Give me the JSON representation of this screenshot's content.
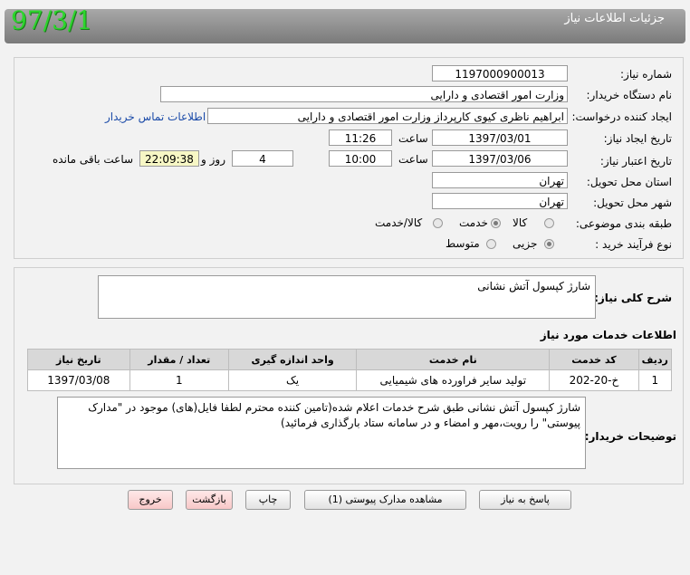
{
  "header": {
    "title": "جزئیات اطلاعات نیاز",
    "date_stamp": "97/3/1"
  },
  "form": {
    "need_number_label": "شماره نیاز:",
    "need_number": "1197000900013",
    "buyer_org_label": "نام دستگاه خریدار:",
    "buyer_org": "وزارت امور اقتصادی و دارایی",
    "requester_label": "ایجاد کننده درخواست:",
    "requester": "ابراهیم  ناظری کیوی کارپرداز وزارت امور اقتصادی و دارایی",
    "contact_link": "اطلاعات تماس خریدار",
    "created_label": "تاریخ ایجاد نیاز:",
    "created_date": "1397/03/01",
    "time_label": "ساعت",
    "created_time": "11:26",
    "validity_label": "تاریخ اعتبار نیاز:",
    "validity_date": "1397/03/06",
    "validity_time": "10:00",
    "days_value": "4",
    "days_label": "روز و",
    "remaining_time": "22:09:38",
    "remaining_label": "ساعت باقی مانده",
    "province_label": "استان محل تحویل:",
    "province": "تهران",
    "city_label": "شهر محل تحویل:",
    "city": "تهران",
    "category_label": "طبقه بندی موضوعی:",
    "category_options": [
      "کالا",
      "خدمت",
      "کالا/خدمت"
    ],
    "category_selected": "خدمت",
    "purchase_type_label": "نوع فرآیند خرید :",
    "purchase_options": [
      "جزیی",
      "متوسط"
    ],
    "purchase_selected": "جزیی"
  },
  "description": {
    "label": "شرح کلی نیاز:",
    "text": "شارژ کپسول آتش نشانی"
  },
  "services": {
    "title": "اطلاعات خدمات مورد نیاز",
    "columns": [
      "ردیف",
      "کد خدمت",
      "نام خدمت",
      "واحد اندازه گیری",
      "تعداد / مقدار",
      "تاریخ نیاز"
    ],
    "rows": [
      [
        "1",
        "خ-20-202",
        "تولید سایر فراورده های شیمیایی",
        "یک",
        "1",
        "1397/03/08"
      ]
    ]
  },
  "buyer_notes": {
    "label": "توضیحات خریدار:",
    "text": "شارژ کپسول آتش نشانی طبق شرح خدمات اعلام شده(تامین کننده محترم لطفا فایل(های) موجود در \"مدارک پیوستی\" را رویت،مهر و امضاء و در سامانه ستاد بارگذاری فرمائید)"
  },
  "buttons": {
    "reply": "پاسخ به نیاز",
    "view_attachments": "مشاهده مدارک پیوستی (1)",
    "print": "چاپ",
    "back": "بازگشت",
    "exit": "خروج"
  },
  "colors": {
    "header_bg": "#8c8c8c",
    "date_stamp": "#2dd62d",
    "link": "#1a4aa8",
    "remaining_bg": "#f7f7c5",
    "pink_button": "#f8c8c8"
  }
}
